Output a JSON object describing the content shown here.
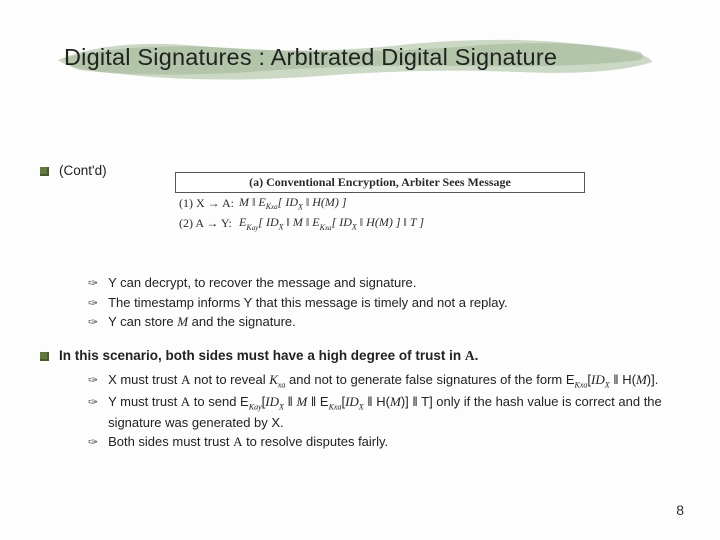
{
  "title": "Digital Signatures : Arbitrated Digital Signature",
  "contd": "(Cont'd)",
  "figure": {
    "caption": "(a) Conventional Encryption, Arbiter Sees Message",
    "line1_num": "(1) X → A:",
    "line1_body": "M ‖ E_Kxa[ ID_X ‖ H(M) ]",
    "line2_num": "(2) A → Y:",
    "line2_body": "E_Kay[ ID_X ‖ M ‖ E_Kxa[ ID_X ‖ H(M) ] ‖ T ]"
  },
  "block1": {
    "b1": "Y can decrypt, to recover the message and signature.",
    "b2": "The timestamp informs Y that this message is timely and not a replay.",
    "b3_a": "Y can store ",
    "b3_m": "M",
    "b3_b": " and the signature."
  },
  "lead2_a": "In this scenario, both sides must have a high degree of trust in ",
  "lead2_A": "A",
  "lead2_b": ".",
  "block2": {
    "r1_a": "X must trust ",
    "r1_A": "A",
    "r1_b": " not to reveal ",
    "r1_K": "K",
    "r1_Ksub": "xa",
    "r1_c": " and not to generate false signatures of the form E",
    "r1_Esub": "Kxa",
    "r1_d": "[",
    "r1_ID": "ID",
    "r1_IDsub": "X",
    "r1_e": " ‖ H(",
    "r1_M": "M",
    "r1_f": ")].",
    "r2_a": "Y must trust ",
    "r2_A": "A",
    "r2_b": " to send E",
    "r2_E1s": "Kay",
    "r2_c": "[",
    "r2_ID1": "ID",
    "r2_ID1s": "X",
    "r2_d": " ‖ ",
    "r2_M": "M",
    "r2_e": " ‖ E",
    "r2_E2s": "Kxa",
    "r2_f": "[",
    "r2_ID2": "ID",
    "r2_ID2s": "X",
    "r2_g": " ‖ H(",
    "r2_M2": "M",
    "r2_h": ")] ‖ T] only if the hash value is correct and the signature was generated by X.",
    "r3_a": "Both sides must trust ",
    "r3_A": "A",
    "r3_b": " to resolve disputes fairly."
  },
  "page": "8"
}
